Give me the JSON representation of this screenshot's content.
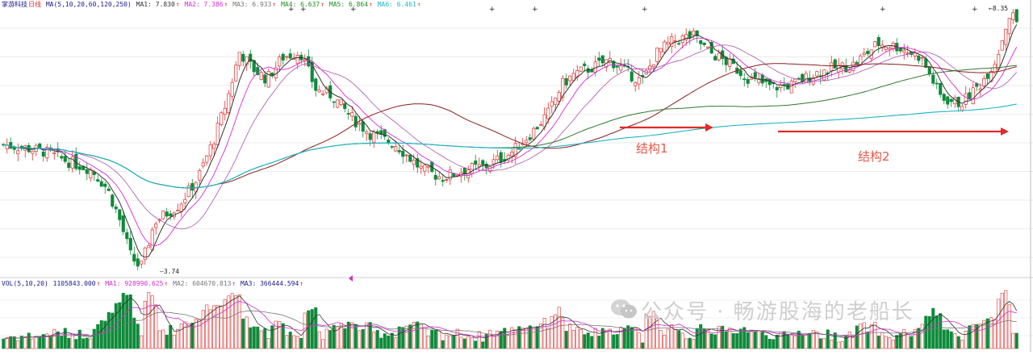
{
  "chart_data": {
    "type": "candlestick",
    "panels": [
      "price",
      "volume"
    ],
    "main_legend": {
      "name": "掌游科技",
      "period": "日线",
      "ma_params": "MA(5,10,20,60,120,250)",
      "items": [
        {
          "label": "MA1:",
          "value": "7.830",
          "color": "#333333"
        },
        {
          "label": "MA2:",
          "value": "7.386",
          "color": "#d62bd6"
        },
        {
          "label": "MA3:",
          "value": "6.933",
          "color": "#777777"
        },
        {
          "label": "MA4:",
          "value": "6.637",
          "color": "#1d8f1d"
        },
        {
          "label": "MA5:",
          "value": "6.864",
          "color": "#1d8f1d"
        },
        {
          "label": "MA6:",
          "value": "6.461",
          "color": "#19b6c8"
        }
      ],
      "arrow": "↑"
    },
    "vol_legend": {
      "params": "VOL(5,10,20)",
      "items": [
        {
          "label": "",
          "value": "1105843.000",
          "color": "#1a1a8a"
        },
        {
          "label": "MA1:",
          "value": "928990.625",
          "color": "#d62bd6"
        },
        {
          "label": "MA2:",
          "value": "604670.813",
          "color": "#777777"
        },
        {
          "label": "MA3:",
          "value": "366444.594",
          "color": "#1a1a8a"
        }
      ],
      "arrow": "↑"
    },
    "price_labels": {
      "low": "3.74",
      "high": "8.35"
    },
    "price_range": [
      3.6,
      8.5
    ],
    "low_point": 3.74,
    "high_point": 8.35,
    "series_count": 280,
    "grid": true,
    "annotations": [
      {
        "text": "结构1",
        "arrow_color": "#e02a2a"
      },
      {
        "text": "结构2",
        "arrow_color": "#e02a2a"
      }
    ],
    "colors": {
      "up": "#e0302f",
      "down": "#0e8a3a",
      "ma5": "#333333",
      "ma10": "#d62bd6",
      "ma20": "#aa55aa",
      "ma60": "#8b1e1e",
      "ma120": "#2f7a2f",
      "ma250": "#19b6c8"
    }
  },
  "watermark": "公众号 · 畅游股海的老船长",
  "window": {
    "title": "日线"
  }
}
